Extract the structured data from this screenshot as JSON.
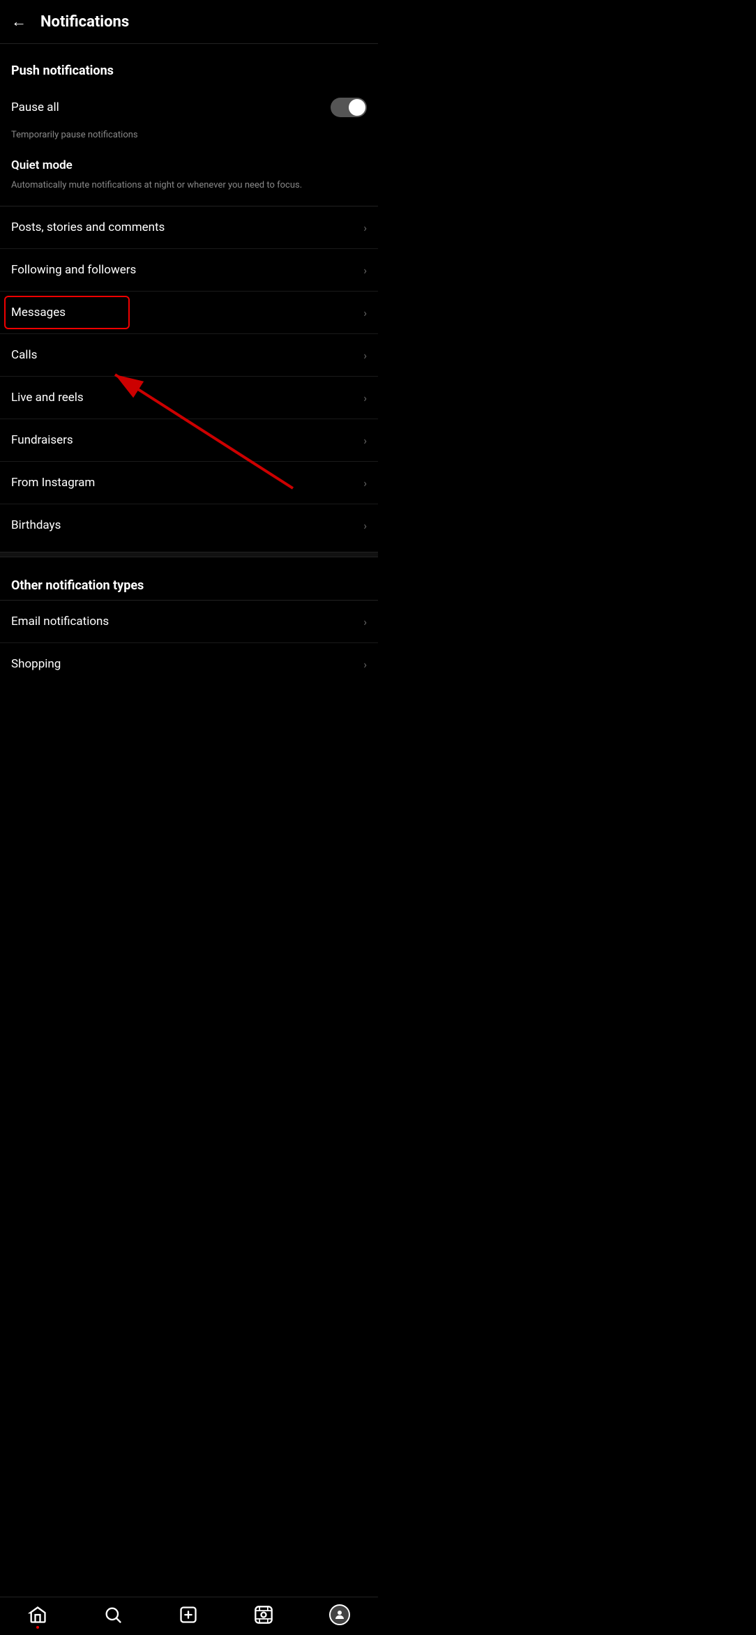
{
  "header": {
    "back_label": "←",
    "title": "Notifications"
  },
  "push_notifications": {
    "section_label": "Push notifications",
    "pause_all": {
      "label": "Pause all",
      "subtitle": "Temporarily pause notifications",
      "toggle_state": "on"
    },
    "quiet_mode": {
      "label": "Quiet mode",
      "description": "Automatically mute notifications at night or whenever you need to focus."
    }
  },
  "nav_items": [
    {
      "id": "posts-stories-comments",
      "label": "Posts, stories and comments"
    },
    {
      "id": "following-followers",
      "label": "Following and followers"
    },
    {
      "id": "messages",
      "label": "Messages",
      "highlighted": true
    },
    {
      "id": "calls",
      "label": "Calls"
    },
    {
      "id": "live-reels",
      "label": "Live and reels"
    },
    {
      "id": "fundraisers",
      "label": "Fundraisers"
    },
    {
      "id": "from-instagram",
      "label": "From Instagram"
    },
    {
      "id": "birthdays",
      "label": "Birthdays"
    }
  ],
  "other_section": {
    "label": "Other notification types",
    "items": [
      {
        "id": "email-notifications",
        "label": "Email notifications"
      },
      {
        "id": "shopping",
        "label": "Shopping"
      }
    ]
  },
  "bottom_nav": {
    "items": [
      {
        "id": "home",
        "icon": "⌂",
        "label": "Home",
        "has_dot": true
      },
      {
        "id": "search",
        "icon": "○",
        "label": "Search"
      },
      {
        "id": "create",
        "icon": "⊞",
        "label": "Create"
      },
      {
        "id": "reels",
        "icon": "▶",
        "label": "Reels"
      },
      {
        "id": "profile",
        "icon": "👤",
        "label": "Profile"
      }
    ]
  },
  "icons": {
    "back": "←",
    "chevron": "❯",
    "home": "🏠",
    "search": "🔍",
    "create": "➕",
    "reels": "📺"
  }
}
